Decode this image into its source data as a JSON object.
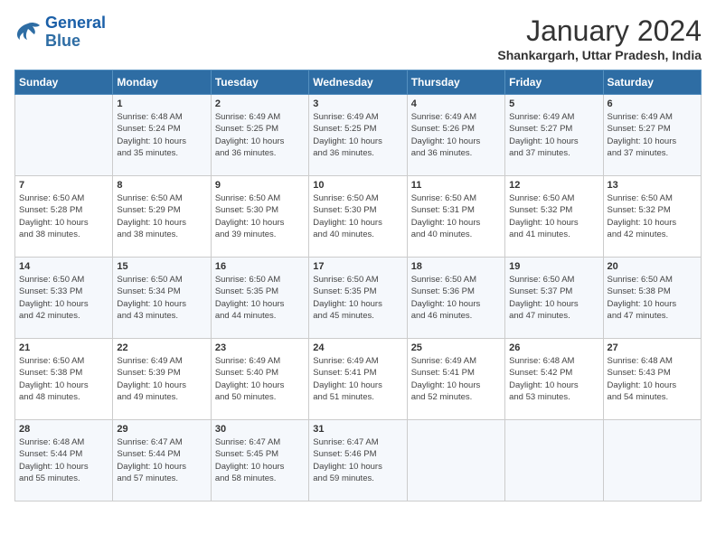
{
  "header": {
    "logo_line1": "General",
    "logo_line2": "Blue",
    "month_title": "January 2024",
    "location": "Shankargarh, Uttar Pradesh, India"
  },
  "days_of_week": [
    "Sunday",
    "Monday",
    "Tuesday",
    "Wednesday",
    "Thursday",
    "Friday",
    "Saturday"
  ],
  "weeks": [
    [
      {
        "day": "",
        "info": ""
      },
      {
        "day": "1",
        "info": "Sunrise: 6:48 AM\nSunset: 5:24 PM\nDaylight: 10 hours\nand 35 minutes."
      },
      {
        "day": "2",
        "info": "Sunrise: 6:49 AM\nSunset: 5:25 PM\nDaylight: 10 hours\nand 36 minutes."
      },
      {
        "day": "3",
        "info": "Sunrise: 6:49 AM\nSunset: 5:25 PM\nDaylight: 10 hours\nand 36 minutes."
      },
      {
        "day": "4",
        "info": "Sunrise: 6:49 AM\nSunset: 5:26 PM\nDaylight: 10 hours\nand 36 minutes."
      },
      {
        "day": "5",
        "info": "Sunrise: 6:49 AM\nSunset: 5:27 PM\nDaylight: 10 hours\nand 37 minutes."
      },
      {
        "day": "6",
        "info": "Sunrise: 6:49 AM\nSunset: 5:27 PM\nDaylight: 10 hours\nand 37 minutes."
      }
    ],
    [
      {
        "day": "7",
        "info": "Sunrise: 6:50 AM\nSunset: 5:28 PM\nDaylight: 10 hours\nand 38 minutes."
      },
      {
        "day": "8",
        "info": "Sunrise: 6:50 AM\nSunset: 5:29 PM\nDaylight: 10 hours\nand 38 minutes."
      },
      {
        "day": "9",
        "info": "Sunrise: 6:50 AM\nSunset: 5:30 PM\nDaylight: 10 hours\nand 39 minutes."
      },
      {
        "day": "10",
        "info": "Sunrise: 6:50 AM\nSunset: 5:30 PM\nDaylight: 10 hours\nand 40 minutes."
      },
      {
        "day": "11",
        "info": "Sunrise: 6:50 AM\nSunset: 5:31 PM\nDaylight: 10 hours\nand 40 minutes."
      },
      {
        "day": "12",
        "info": "Sunrise: 6:50 AM\nSunset: 5:32 PM\nDaylight: 10 hours\nand 41 minutes."
      },
      {
        "day": "13",
        "info": "Sunrise: 6:50 AM\nSunset: 5:32 PM\nDaylight: 10 hours\nand 42 minutes."
      }
    ],
    [
      {
        "day": "14",
        "info": "Sunrise: 6:50 AM\nSunset: 5:33 PM\nDaylight: 10 hours\nand 42 minutes."
      },
      {
        "day": "15",
        "info": "Sunrise: 6:50 AM\nSunset: 5:34 PM\nDaylight: 10 hours\nand 43 minutes."
      },
      {
        "day": "16",
        "info": "Sunrise: 6:50 AM\nSunset: 5:35 PM\nDaylight: 10 hours\nand 44 minutes."
      },
      {
        "day": "17",
        "info": "Sunrise: 6:50 AM\nSunset: 5:35 PM\nDaylight: 10 hours\nand 45 minutes."
      },
      {
        "day": "18",
        "info": "Sunrise: 6:50 AM\nSunset: 5:36 PM\nDaylight: 10 hours\nand 46 minutes."
      },
      {
        "day": "19",
        "info": "Sunrise: 6:50 AM\nSunset: 5:37 PM\nDaylight: 10 hours\nand 47 minutes."
      },
      {
        "day": "20",
        "info": "Sunrise: 6:50 AM\nSunset: 5:38 PM\nDaylight: 10 hours\nand 47 minutes."
      }
    ],
    [
      {
        "day": "21",
        "info": "Sunrise: 6:50 AM\nSunset: 5:38 PM\nDaylight: 10 hours\nand 48 minutes."
      },
      {
        "day": "22",
        "info": "Sunrise: 6:49 AM\nSunset: 5:39 PM\nDaylight: 10 hours\nand 49 minutes."
      },
      {
        "day": "23",
        "info": "Sunrise: 6:49 AM\nSunset: 5:40 PM\nDaylight: 10 hours\nand 50 minutes."
      },
      {
        "day": "24",
        "info": "Sunrise: 6:49 AM\nSunset: 5:41 PM\nDaylight: 10 hours\nand 51 minutes."
      },
      {
        "day": "25",
        "info": "Sunrise: 6:49 AM\nSunset: 5:41 PM\nDaylight: 10 hours\nand 52 minutes."
      },
      {
        "day": "26",
        "info": "Sunrise: 6:48 AM\nSunset: 5:42 PM\nDaylight: 10 hours\nand 53 minutes."
      },
      {
        "day": "27",
        "info": "Sunrise: 6:48 AM\nSunset: 5:43 PM\nDaylight: 10 hours\nand 54 minutes."
      }
    ],
    [
      {
        "day": "28",
        "info": "Sunrise: 6:48 AM\nSunset: 5:44 PM\nDaylight: 10 hours\nand 55 minutes."
      },
      {
        "day": "29",
        "info": "Sunrise: 6:47 AM\nSunset: 5:44 PM\nDaylight: 10 hours\nand 57 minutes."
      },
      {
        "day": "30",
        "info": "Sunrise: 6:47 AM\nSunset: 5:45 PM\nDaylight: 10 hours\nand 58 minutes."
      },
      {
        "day": "31",
        "info": "Sunrise: 6:47 AM\nSunset: 5:46 PM\nDaylight: 10 hours\nand 59 minutes."
      },
      {
        "day": "",
        "info": ""
      },
      {
        "day": "",
        "info": ""
      },
      {
        "day": "",
        "info": ""
      }
    ]
  ]
}
